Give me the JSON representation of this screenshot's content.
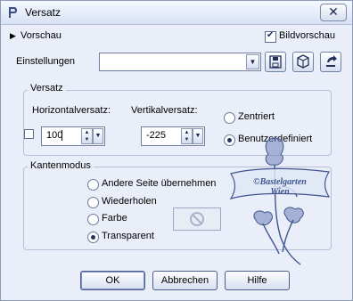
{
  "window": {
    "title": "Versatz"
  },
  "header": {
    "preview_toggle_label": "Vorschau",
    "image_preview_label": "Bildvorschau",
    "image_preview_checked": true
  },
  "settings": {
    "label": "Einstellungen",
    "value": ""
  },
  "offset": {
    "group_title": "Versatz",
    "horizontal_label": "Horizontalversatz:",
    "horizontal_value": "100",
    "vertical_label": "Vertikalversatz:",
    "vertical_value": "-225",
    "centered_label": "Zentriert",
    "custom_label": "Benutzerdefiniert",
    "selected": "custom"
  },
  "edge_mode": {
    "group_title": "Kantenmodus",
    "options": [
      "Andere Seite übernehmen",
      "Wiederholen",
      "Farbe",
      "Transparent"
    ],
    "selected": "Transparent"
  },
  "watermark": {
    "line1": "©Bastelgarten",
    "line2": "Wien"
  },
  "buttons": {
    "ok": "OK",
    "cancel": "Abbrechen",
    "help": "Hilfe"
  },
  "colors": {
    "accent": "#26355e",
    "background": "#e9eef8",
    "watermark": "#4a5f99"
  }
}
